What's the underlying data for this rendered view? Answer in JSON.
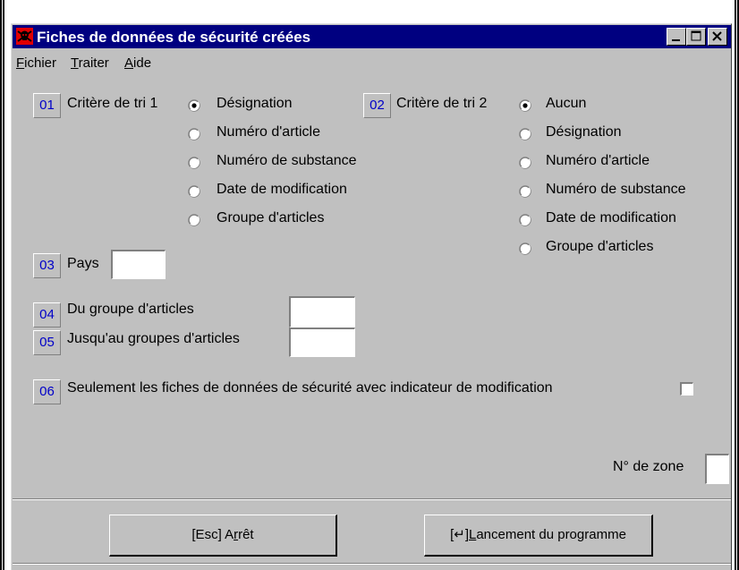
{
  "window": {
    "title": "Fiches de données de sécurité créées"
  },
  "menu": {
    "items": [
      {
        "label_first": "F",
        "label_rest": "ichier"
      },
      {
        "label_first": "T",
        "label_rest": "raiter"
      },
      {
        "label_first": "A",
        "label_rest": "ide"
      }
    ]
  },
  "form": {
    "sort1": {
      "tag": "01",
      "label": "Critère de tri 1",
      "options": [
        "Désignation",
        "Numéro d'article",
        "Numéro de substance",
        "Date de modification",
        "Groupe d'articles"
      ],
      "selected": "Désignation"
    },
    "sort2": {
      "tag": "02",
      "label": "Critère de tri 2",
      "options": [
        "Aucun",
        "Désignation",
        "Numéro d'article",
        "Numéro de substance",
        "Date de modification",
        "Groupe d'articles"
      ],
      "selected": "Aucun"
    },
    "country": {
      "tag": "03",
      "label": "Pays",
      "value": ""
    },
    "group_from": {
      "tag": "04",
      "label": "Du groupe d'articles",
      "value": ""
    },
    "group_to": {
      "tag": "05",
      "label": "Jusqu'au groupes d'articles",
      "value": ""
    },
    "modified_only": {
      "tag": "06",
      "label": "Seulement les fiches de données de sécurité avec indicateur de modification",
      "checked": false
    },
    "zone": {
      "label": "N° de zone",
      "value": ""
    }
  },
  "buttons": {
    "stop": {
      "prefix": "[Esc] A",
      "accel": "r",
      "suffix": "rêt"
    },
    "launch": {
      "prefix": "[↵] ",
      "accel": "L",
      "suffix": "ancement du programme"
    }
  },
  "colors": {
    "titlebar": "#000080",
    "tag_text": "#0000c8",
    "window_bg": "#c0c0c0"
  },
  "icons": {
    "app": "hazard-skull-icon",
    "minimize": "minimize-icon",
    "maximize": "maximize-icon",
    "close": "close-icon"
  }
}
